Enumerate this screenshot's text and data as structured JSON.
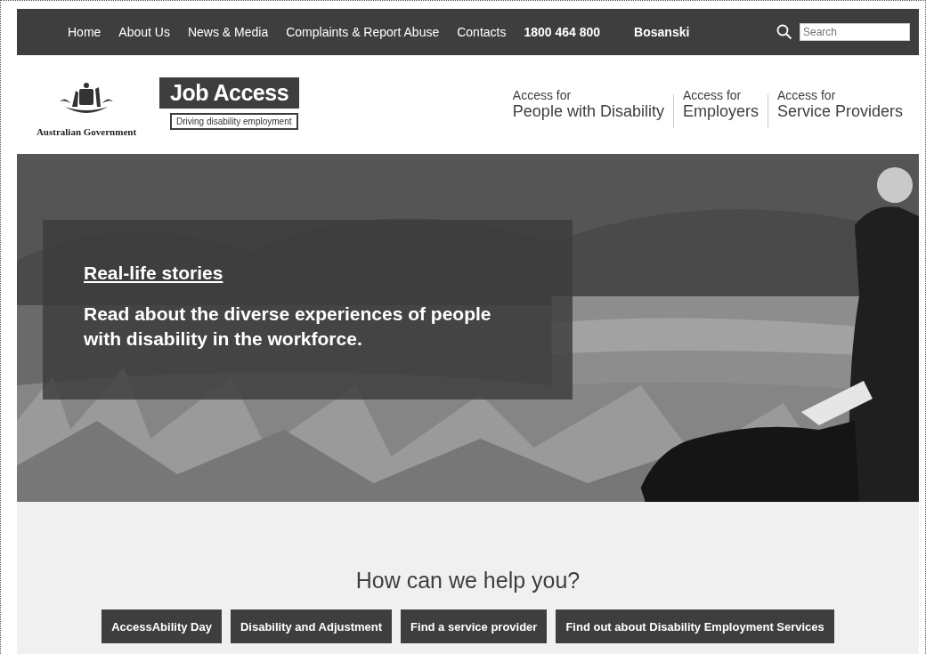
{
  "top_nav": {
    "links": [
      "Home",
      "About Us",
      "News & Media",
      "Complaints & Report Abuse",
      "Contacts"
    ],
    "phone": "1800 464 800",
    "language": "Bosanski",
    "search": {
      "placeholder": "Search"
    }
  },
  "header": {
    "government": "Australian Government",
    "brand": "Job Access",
    "tagline": "Driving disability employment",
    "access_links": [
      {
        "prefix": "Access for",
        "label": "People with Disability"
      },
      {
        "prefix": "Access for",
        "label": "Employers"
      },
      {
        "prefix": "Access for",
        "label": "Service Providers"
      }
    ]
  },
  "hero": {
    "link": "Real-life stories",
    "text": "Read about the diverse experiences of people with disability in the workforce."
  },
  "help": {
    "heading": "How can we help you?",
    "buttons": [
      "AccessAbility Day",
      "Disability and Adjustment",
      "Find a service provider",
      "Find out about Disability Employment Services"
    ]
  }
}
